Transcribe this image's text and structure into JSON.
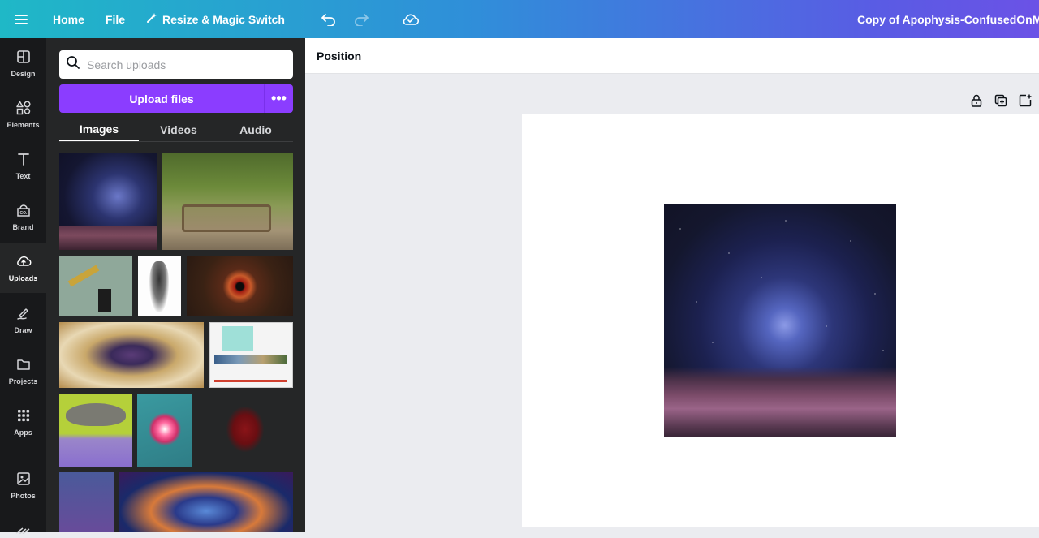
{
  "topbar": {
    "home": "Home",
    "file": "File",
    "resize": "Resize & Magic Switch",
    "doc_title": "Copy of Apophysis-ConfusedOnMany"
  },
  "rail": {
    "items": [
      {
        "label": "Design",
        "icon": "design-icon"
      },
      {
        "label": "Elements",
        "icon": "elements-icon"
      },
      {
        "label": "Text",
        "icon": "text-icon"
      },
      {
        "label": "Brand",
        "icon": "brand-icon"
      },
      {
        "label": "Uploads",
        "icon": "cloud-upload-icon"
      },
      {
        "label": "Draw",
        "icon": "draw-icon"
      },
      {
        "label": "Projects",
        "icon": "folder-icon"
      },
      {
        "label": "Apps",
        "icon": "apps-icon"
      },
      {
        "label": "Photos",
        "icon": "photos-icon"
      }
    ]
  },
  "panel": {
    "search_placeholder": "Search uploads",
    "upload_label": "Upload files",
    "more_label": "•••",
    "tabs": [
      "Images",
      "Videos",
      "Audio"
    ]
  },
  "toolbar": {
    "position_label": "Position"
  },
  "colors": {
    "accent": "#8b3dff",
    "rail_bg": "#18191b",
    "panel_bg": "#252627"
  }
}
